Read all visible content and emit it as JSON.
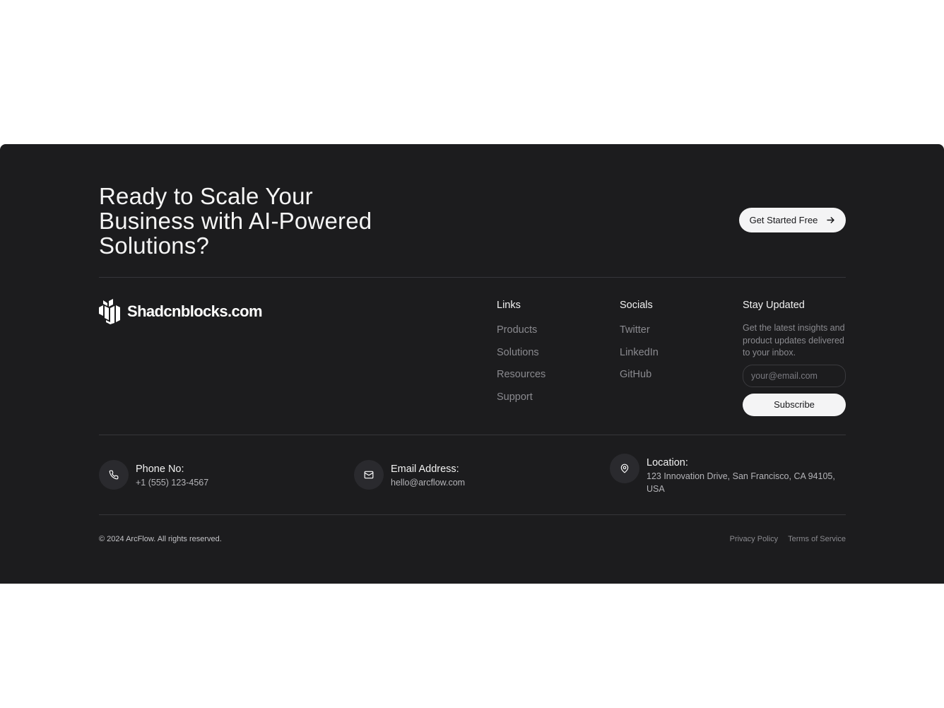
{
  "cta": {
    "headline": "Ready to Scale Your Business with AI-Powered Solutions?",
    "button_label": "Get Started Free",
    "button_icon": "arrow-right-icon"
  },
  "brand": {
    "logo_icon": "shadcnblocks-logo-icon",
    "name": "Shadcnblocks.com"
  },
  "links": {
    "title": "Links",
    "items": [
      "Products",
      "Solutions",
      "Resources",
      "Support"
    ]
  },
  "socials": {
    "title": "Socials",
    "items": [
      "Twitter",
      "LinkedIn",
      "GitHub"
    ]
  },
  "newsletter": {
    "title": "Stay Updated",
    "description": "Get the latest insights and product updates delivered to your inbox.",
    "placeholder": "your@email.com",
    "button_label": "Subscribe"
  },
  "contacts": [
    {
      "icon": "phone-icon",
      "label": "Phone No:",
      "value": "+1 (555) 123-4567"
    },
    {
      "icon": "mail-icon",
      "label": "Email Address:",
      "value": "hello@arcflow.com"
    },
    {
      "icon": "map-pin-icon",
      "label": "Location:",
      "value": "123 Innovation Drive, San Francisco, CA 94105, USA"
    }
  ],
  "bottom": {
    "copyright": "© 2024 ArcFlow. All rights reserved.",
    "privacy": "Privacy Policy",
    "terms": "Terms of Service"
  },
  "colors": {
    "footer_bg": "#1c1c1e",
    "button_bg": "#f4f4f5",
    "muted_text": "#8a8a8f"
  }
}
